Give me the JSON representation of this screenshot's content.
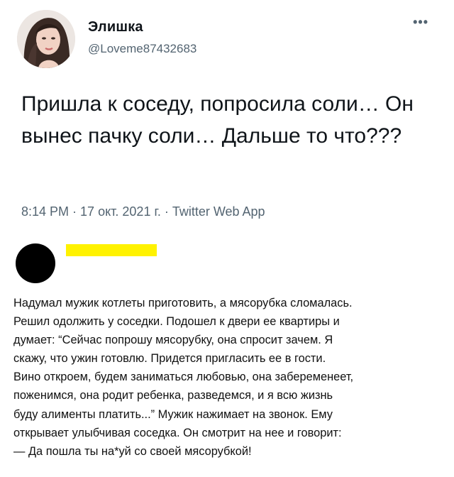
{
  "tweet": {
    "author_name": "Элишка",
    "author_handle": "@Loveme87432683",
    "more_icon": "more-dots-icon",
    "text": "Пришла к соседу, попросила соли… Он вынес пачку соли… Дальше то что???",
    "time": "8:14 PM",
    "date": "17 окт. 2021 г.",
    "source": "Twitter Web App",
    "separator": " · "
  },
  "reply": {
    "lines": [
      "Надумал мужик котлеты приготовить, а мясорубка сломалась.",
      "Решил одолжить у соседки. Подошел к двери ее квартиры и",
      "думает: “Сейчас попрошу мясорубку, она спросит зачем. Я",
      "скажу, что ужин готовлю. Придется пригласить ее в гости.",
      "Вино откроем, будем заниматься любовью, она забеременеет,",
      "поженимся, она родит ребенка, разведемся, и я всю жизнь",
      "буду алименты платить...” Мужик нажимает на звонок. Ему",
      "открывает улыбчивая соседка. Он смотрит на нее и говорит:",
      "— Да пошла ты на*уй со своей мясорубкой!"
    ],
    "redaction_color": "#fff200"
  },
  "colors": {
    "text_primary": "#0f1419",
    "text_secondary": "#536471"
  }
}
